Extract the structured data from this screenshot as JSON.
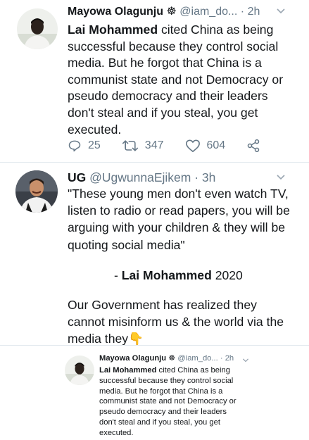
{
  "tweet1": {
    "name": "Mayowa Olagunju",
    "badge": "☸",
    "handle": "@iam_do...",
    "dot": "·",
    "time": "2h",
    "text_bold": "Lai Mohammed",
    "text_lines": [
      " cited China as being",
      "successful because they control social",
      "media. But he forgot that China is a",
      "communist state and not Democracy or",
      "pseudo democracy and their leaders",
      "don't steal and if you steal, you get",
      "executed."
    ],
    "replies": "25",
    "retweets": "347",
    "likes": "604"
  },
  "tweet2": {
    "name": "UG",
    "handle": "@UgwunnaEjikem",
    "dot": "·",
    "time": "3h",
    "quote_lines": [
      "\"These young men don't even watch TV,",
      "listen to radio or read papers, you will be",
      "arguing with your children & they will be",
      "quoting social media\""
    ],
    "attribution_prefix": "- ",
    "attribution_bold": "Lai Mohammed",
    "attribution_year": " 2020",
    "closing_lines": [
      "Our Government has realized they",
      "cannot misinform us & the world via the",
      "media they"
    ],
    "emoji": "👇"
  },
  "tweet3": {
    "name": "Mayowa Olagunju",
    "badge": "☸",
    "handle": "@iam_do...",
    "dot": "·",
    "time": "2h",
    "text_bold": "Lai Mohammed",
    "text_lines": [
      " cited China as being",
      "successful because they control social",
      "media. But he forgot that China is a",
      "communist state and not Democracy or",
      "pseudo democracy and their leaders",
      "don't steal and if you steal, you get",
      "executed."
    ]
  },
  "icons": {
    "reply": "reply-icon",
    "retweet": "retweet-icon",
    "like": "heart-icon",
    "share": "share-icon",
    "chevron": "chevron-down-icon"
  },
  "colors": {
    "text": "#14171a",
    "secondary": "#657786",
    "divider": "#e1e8ed"
  }
}
